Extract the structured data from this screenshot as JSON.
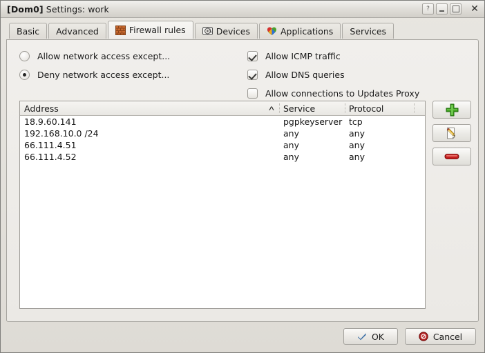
{
  "window": {
    "title_prefix": "[Dom0]",
    "title_rest": "Settings: work",
    "help_label": "?",
    "minimize_label": "minimize",
    "maximize_label": "maximize",
    "close_label": "✕"
  },
  "tabs": [
    {
      "label": "Basic",
      "icon": "",
      "active": false
    },
    {
      "label": "Advanced",
      "icon": "",
      "active": false
    },
    {
      "label": "Firewall rules",
      "icon": "brick-wall-icon",
      "active": true
    },
    {
      "label": "Devices",
      "icon": "hard-disk-icon",
      "active": false
    },
    {
      "label": "Applications",
      "icon": "puzzle-icon",
      "active": false
    },
    {
      "label": "Services",
      "icon": "",
      "active": false
    }
  ],
  "policy": {
    "options": [
      {
        "label": "Allow network access except...",
        "selected": false
      },
      {
        "label": "Deny network access except...",
        "selected": true
      }
    ]
  },
  "toggles": [
    {
      "label": "Allow ICMP traffic",
      "checked": true
    },
    {
      "label": "Allow DNS queries",
      "checked": true
    },
    {
      "label": "Allow connections to Updates Proxy",
      "checked": false
    }
  ],
  "rules_table": {
    "columns": [
      {
        "key": "address",
        "label": "Address",
        "sorted": "asc"
      },
      {
        "key": "service",
        "label": "Service",
        "sorted": ""
      },
      {
        "key": "protocol",
        "label": "Protocol",
        "sorted": ""
      }
    ],
    "sort_caret": "ʌ",
    "rows": [
      {
        "address": "18.9.60.141",
        "service": "pgpkeyserver",
        "protocol": "tcp"
      },
      {
        "address": "192.168.10.0 /24",
        "service": "any",
        "protocol": "any"
      },
      {
        "address": "66.111.4.51",
        "service": "any",
        "protocol": "any"
      },
      {
        "address": "66.111.4.52",
        "service": "any",
        "protocol": "any"
      }
    ]
  },
  "rule_actions": [
    {
      "name": "add",
      "icon": "plus-icon",
      "tooltip": "Add rule"
    },
    {
      "name": "edit",
      "icon": "pencil-icon",
      "tooltip": "Edit rule"
    },
    {
      "name": "remove",
      "icon": "minus-icon",
      "tooltip": "Remove rule"
    }
  ],
  "dialog_buttons": {
    "ok_label": "OK",
    "cancel_label": "Cancel"
  },
  "colors": {
    "window_bg": "#e8e6e1",
    "panel_bg": "#f1efec",
    "list_bg": "#ffffff",
    "text": "#1b1b1b",
    "border": "#a6a49f",
    "accent_add": "#3a9c2e",
    "accent_remove": "#c42020",
    "accent_ok": "#3b6ea5",
    "accent_cancel": "#b02020"
  }
}
